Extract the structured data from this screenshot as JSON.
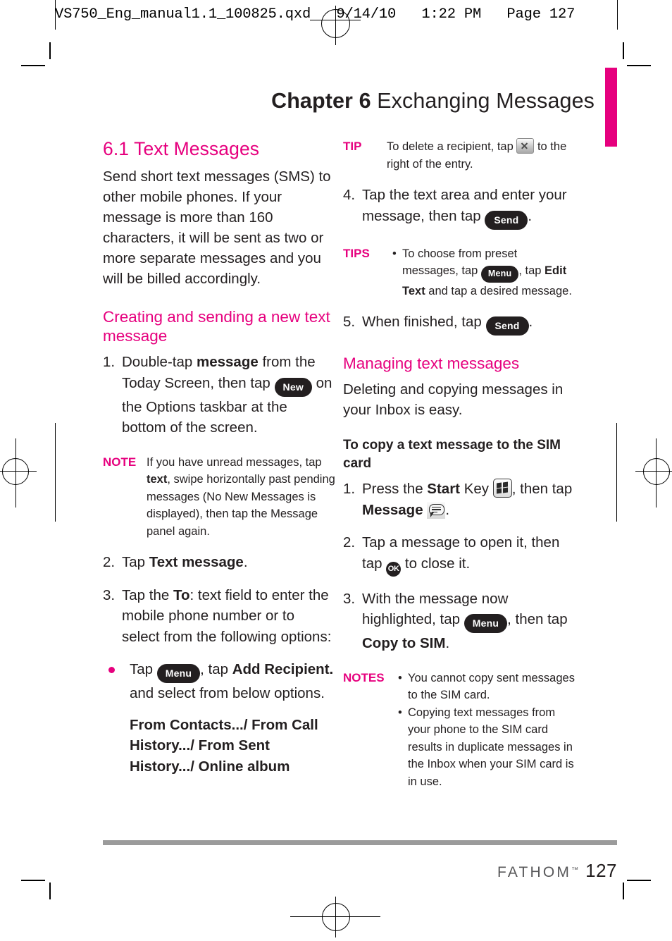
{
  "prepress": {
    "header_line": "VS750_Eng_manual1.1_100825.qxd   9/14/10   1:22 PM   Page 127"
  },
  "chapter": {
    "number_label": "Chapter 6",
    "title": "Exchanging Messages",
    "accent_color": "#e6007e"
  },
  "left_column": {
    "section_heading": "6.1 Text Messages",
    "intro_paragraph": "Send short text messages (SMS) to other mobile phones. If your message is more than 160 characters, it will be sent as two or more separate messages and you will be billed accordingly.",
    "subheading_creating": "Creating and sending a new text message",
    "step1": {
      "marker": "1.",
      "part_a": "Double-tap ",
      "bold_a": "message",
      "part_b": " from the Today Screen, then tap ",
      "chip": "New",
      "part_c": " on the Options taskbar at the bottom of the screen."
    },
    "note": {
      "kicker": "NOTE",
      "part_a": "If you have unread messages, tap ",
      "bold_a": "text",
      "part_b": ", swipe horizontally past pending messages (No New Messages is displayed), then tap the Message panel again."
    },
    "step2": {
      "marker": "2.",
      "part_a": "Tap ",
      "bold_a": "Text message",
      "part_b": "."
    },
    "step3": {
      "marker": "3.",
      "part_a": "Tap the ",
      "bold_a": "To",
      "part_b": ": text field to enter the mobile phone number or to select from the following options:"
    },
    "bullet1": {
      "part_a": "Tap ",
      "chip": "Menu",
      "part_b": ", tap ",
      "bold_a": "Add Recipient.",
      "part_c": " and select from below options."
    },
    "options_line": "From Contacts.../ From Call History.../ From Sent History.../ Online album"
  },
  "right_column": {
    "tip": {
      "kicker": "TIP",
      "part_a": "To delete a recipient, tap ",
      "icon": "close-x-icon",
      "part_b": " to the right of the entry."
    },
    "step4": {
      "marker": "4.",
      "part_a": "Tap the text area and enter your message, then tap ",
      "chip": "Send",
      "part_b": "."
    },
    "tips": {
      "kicker": "TIPS",
      "part_a": "To choose from preset messages, tap ",
      "chip": "Menu",
      "part_b": ", tap ",
      "bold_a": "Edit Text",
      "part_c": " and tap a desired message."
    },
    "step5": {
      "marker": "5.",
      "part_a": "When finished, tap ",
      "chip": "Send",
      "part_b": "."
    },
    "subheading_managing": "Managing text messages",
    "managing_paragraph": "Deleting and copying messages in your Inbox is easy.",
    "subheading_copy_sim": "To copy a text message to the SIM card",
    "step_sim_1": {
      "marker": "1.",
      "part_a": "Press the ",
      "bold_a": "Start",
      "part_b": " Key ",
      "icon_start": "windows-start-icon",
      "part_c": ", then tap ",
      "bold_b": "Message",
      "icon_message": "message-bubble-icon",
      "part_d": "."
    },
    "step_sim_2": {
      "marker": "2.",
      "part_a": "Tap a message to open it, then tap ",
      "icon_ok": "OK",
      "part_b": " to close it."
    },
    "step_sim_3": {
      "marker": "3.",
      "part_a": "With the message now highlighted, tap ",
      "chip": "Menu",
      "part_b": ", then tap ",
      "bold_a": "Copy to SIM",
      "part_c": "."
    },
    "notes": {
      "kicker": "NOTES",
      "item1": "You cannot copy sent messages to the SIM card.",
      "item2": "Copying text messages from your phone to the SIM card results in duplicate messages in the Inbox when your SIM card is in use."
    }
  },
  "footer": {
    "brand": "FATHOM",
    "brand_tm": "™",
    "page_number": "127"
  }
}
